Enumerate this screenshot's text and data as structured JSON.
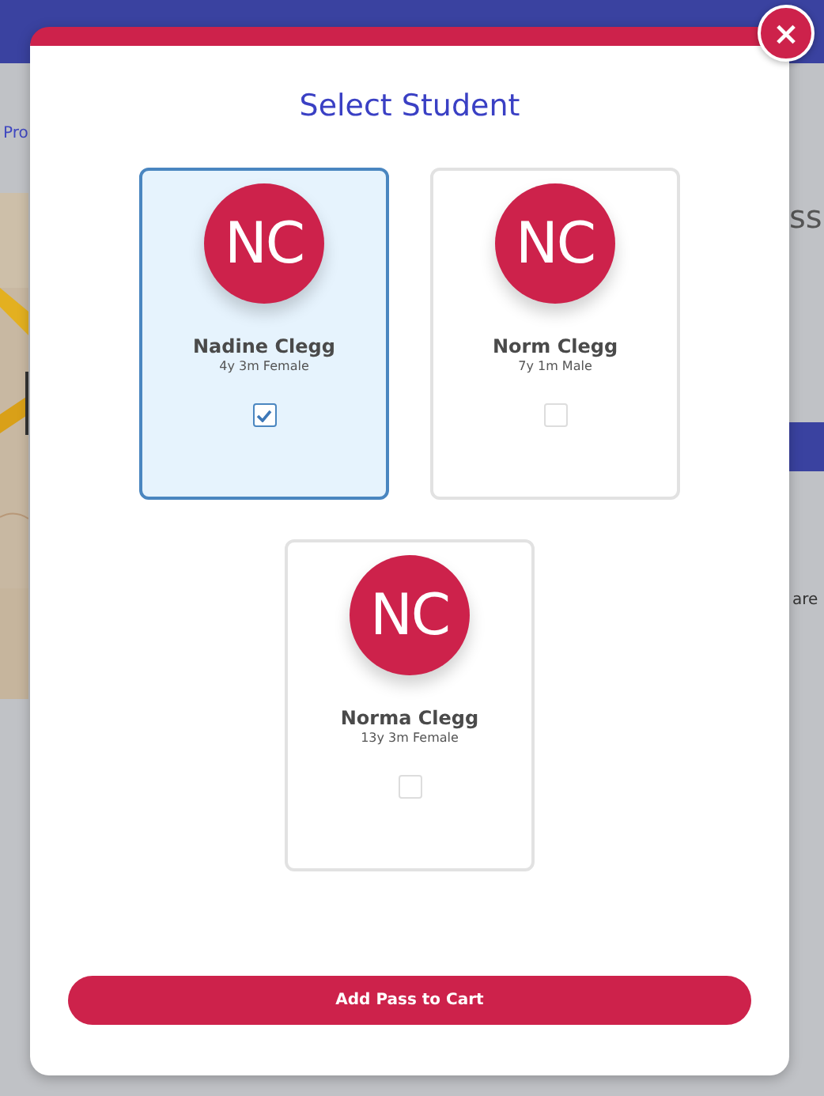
{
  "background": {
    "link_fragment": "Pro",
    "heading_fragment": "ss",
    "text_fragment": "are"
  },
  "dialog": {
    "title": "Select Student",
    "students": [
      {
        "initials": "NC",
        "name": "Nadine Clegg",
        "details": "4y 3m Female",
        "selected": true
      },
      {
        "initials": "NC",
        "name": "Norm Clegg",
        "details": "7y 1m Male",
        "selected": false
      },
      {
        "initials": "NC",
        "name": "Norma Clegg",
        "details": "13y 3m Female",
        "selected": false
      }
    ],
    "close_label": "×",
    "action_button": "Add Pass to Cart"
  }
}
